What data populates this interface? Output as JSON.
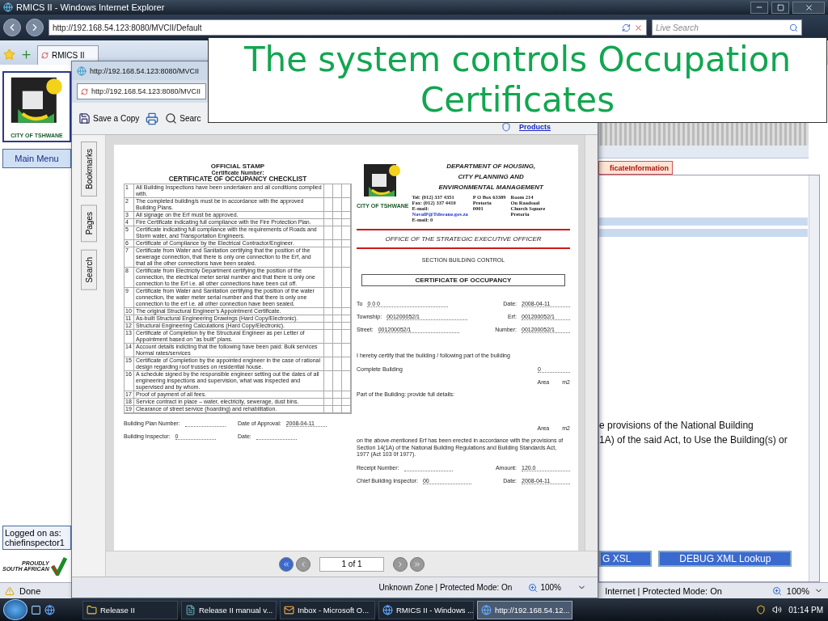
{
  "browser": {
    "title": "RMICS II - Windows Internet Explorer",
    "address": "http://192.168.54.123:8080/MVCII/Default",
    "search_placeholder": "Live Search",
    "tab": "RMICS II"
  },
  "app": {
    "logo_caption": "CITY OF TSHWANE",
    "main_menu": "Main Menu",
    "logged_on_label": "Logged on as:",
    "user": "chiefinspector1",
    "footer_logo": [
      "PROUDLY",
      "SOUTH AFRICAN"
    ],
    "tab": "ficateInformation",
    "text_lines": [
      "e provisions of the National Building",
      "1A) of the said Act, to Use the Building(s) or"
    ],
    "buttons": [
      "G XSL",
      "DEBUG XML Lookup"
    ]
  },
  "popup": {
    "title": "http://192.168.54.123:8080/MVCII",
    "address": "http://192.168.54.123:8080/MVCII",
    "toolbar": {
      "save": "Save a Copy",
      "search": "Searc",
      "link": "Products"
    },
    "side_tabs": [
      "Bookmarks",
      "Pages",
      "Search"
    ],
    "checklist": {
      "heading": "OFFICIAL STAMP",
      "certificate_number_label": "Certificate Number:",
      "title": "CERTIFICATE OF OCCUPANCY CHECKLIST",
      "items": [
        {
          "number": "1",
          "text": "All Building Inspections have been undertaken and all conditions complied with."
        },
        {
          "number": "2",
          "text": "The completed building/s must be in accordance with the approved Building Plans."
        },
        {
          "number": "3",
          "text": "All signage on the Erf must be approved."
        },
        {
          "number": "4",
          "text": "Fire Certificate indicating full compliance with the Fire Protection Plan."
        },
        {
          "number": "5",
          "text": "Certificate indicating full compliance with the requirements of Roads and Storm water, and Transportation Engineers."
        },
        {
          "number": "6",
          "text": "Certificate of Compliance by the Electrical Contractor/Engineer."
        },
        {
          "number": "7",
          "text": "Certificate from Water and Sanitation certifying that the position of the sewerage connection, that there is only one connection to the Erf, and that all the other connections have been sealed."
        },
        {
          "number": "8",
          "text": "Certificate from Electricity Department certifying the position of the connection, the electrical meter serial number and that there is only one connection to the Erf i.e. all other connections have been cut off."
        },
        {
          "number": "9",
          "text": "Certificate from Water and Sanitation certifying the position of the water connection, the water meter serial number and that there is only one connection to the erf i.e. all other connection have been sealed."
        },
        {
          "number": "10",
          "text": "The original Structural Engineer's Appointment Certificate."
        },
        {
          "number": "11",
          "text": "As-built Structural Engineering Drawings (Hard Copy/Electronic)."
        },
        {
          "number": "12",
          "text": "Structural Engineering Calculations (Hard Copy/Electronic)."
        },
        {
          "number": "13",
          "text": "Certificate of Completion by the Structural Engineer as per Letter of Appointment based on \"as built\" plans."
        },
        {
          "number": "14",
          "text": "Account details indicting that the following have been paid: Bulk services Normal rates/services"
        },
        {
          "number": "15",
          "text": "Certificate of Completion by the appointed engineer in the case of rational design regarding roof trusses on residential house."
        },
        {
          "number": "16",
          "text": "A schedule signed by the responsible engineer setting out the dates of all engineering inspections and supervision, what was inspected and supervised and by whom."
        },
        {
          "number": "17",
          "text": "Proof of payment of all fees."
        },
        {
          "number": "18",
          "text": "Service contract in place – water, electricity, sewerage, dust bins."
        },
        {
          "number": "19",
          "text": "Clearance of street service (hoarding) and rehabilitation."
        }
      ],
      "fields": [
        {
          "label": "Building Plan Number:"
        },
        {
          "label": "Date of Approval:",
          "value": "2008-04-11"
        },
        {
          "label": "Building Inspector:",
          "value": "0"
        },
        {
          "label": "Date:"
        }
      ]
    },
    "certificate": {
      "logo_caption": "CITY OF TSHWANE",
      "department": [
        "DEPARTMENT OF HOUSING,",
        "CITY PLANNING AND",
        "ENVIRONMENTAL MANAGEMENT"
      ],
      "contacts": [
        [
          {
            "text": "Tel: (012) 337 4351",
            "kind": "text"
          },
          {
            "text": "Fax: (012) 337 4410",
            "kind": "text"
          },
          {
            "text": "E-mail:",
            "kind": "text"
          },
          {
            "text": "NavalP@Tshwane.gov.za",
            "kind": "link"
          },
          {
            "text": "E-mail: 0",
            "kind": "text"
          }
        ],
        [
          {
            "text": "P O Box 63389",
            "kind": "text"
          },
          {
            "text": "Pretoria",
            "kind": "text"
          },
          {
            "text": "0001",
            "kind": "text"
          }
        ],
        [
          {
            "text": "Room 214",
            "kind": "text"
          },
          {
            "text": "Ou Raadsaal",
            "kind": "text"
          },
          {
            "text": "Church Square",
            "kind": "text"
          },
          {
            "text": "Pretoria",
            "kind": "text"
          }
        ]
      ],
      "office": "OFFICE OF THE STRATEGIC EXECUTIVE OFFICER",
      "section": "SECTION BUILDING CONTROL",
      "title": "CERTIFICATE OF OCCUPANCY",
      "fields": [
        [
          {
            "label": "To",
            "value": "0 0 0"
          },
          {
            "label": "Date:",
            "value": "2008-04-11"
          }
        ],
        [
          {
            "label": "Township:",
            "value": "001200052/1"
          },
          {
            "label": "Erf:",
            "value": "001200052/1"
          }
        ],
        [
          {
            "label": "Street:",
            "value": "001200052/1"
          },
          {
            "label": "Number:",
            "value": "001200052/1"
          }
        ]
      ],
      "certify_text": "I hereby certify that the building / following part of the building",
      "complete_building": {
        "label": "Complete Building",
        "value": "0",
        "area_label": "Area",
        "unit": "m2"
      },
      "part_label": "Part of the Building: provide full details:",
      "part_area": {
        "area_label": "Area",
        "unit": "m2"
      },
      "provisions": "on the above-mentioned Erf has been erected in accordance with the provisions of Section 14(1A) of the National Building Regulations and Building Standards Act, 1977 (Act 103 0f 1977).",
      "signoff": [
        [
          {
            "label": "Receipt Number:"
          },
          {
            "label": "Amount:",
            "value": "120.0"
          }
        ],
        [
          {
            "label": "Chief Building Inspector:",
            "value": "00"
          },
          {
            "label": "Date:",
            "value": "2008-04-11"
          }
        ]
      ]
    },
    "page_indicator": "1 of 1",
    "status": "Unknown Zone | Protected Mode: On",
    "zoom": "100%"
  },
  "overlay": {
    "title": "The system controls Occupation Certificates"
  },
  "status_bar": {
    "text": "Done",
    "zone": "Internet | Protected Mode: On",
    "zoom": "100%"
  },
  "taskbar": {
    "items": [
      {
        "label": "Release II",
        "kind": "folder",
        "selected": false
      },
      {
        "label": "Release II  manual v...",
        "kind": "document",
        "selected": false
      },
      {
        "label": "Inbox - Microsoft O...",
        "kind": "mail",
        "selected": false
      },
      {
        "label": "RMICS II - Windows ...",
        "kind": "browser",
        "selected": false
      },
      {
        "label": "http://192.168.54.12...",
        "kind": "browser",
        "selected": true
      }
    ],
    "clock": "01:14 PM"
  }
}
